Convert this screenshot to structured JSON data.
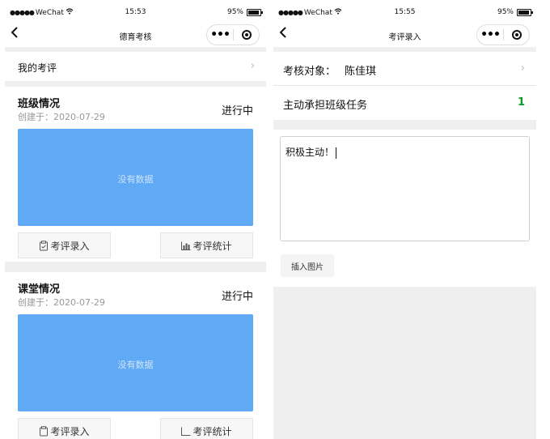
{
  "left": {
    "status": {
      "carrier": "WeChat",
      "time": "15:53",
      "battery": "95%"
    },
    "nav": {
      "title": "德育考核"
    },
    "my_eval": {
      "label": "我的考评"
    },
    "cards": [
      {
        "title": "班级情况",
        "created": "创建于：2020-07-29",
        "status": "进行中",
        "nodata": "没有数据",
        "btn1": "考评录入",
        "btn2": "考评统计"
      },
      {
        "title": "课堂情况",
        "created": "创建于：2020-07-29",
        "status": "进行中",
        "nodata": "没有数据",
        "btn1": "考评录入",
        "btn2": "考评统计"
      }
    ]
  },
  "right": {
    "status": {
      "carrier": "WeChat",
      "time": "15:55",
      "battery": "95%"
    },
    "nav": {
      "title": "考评录入"
    },
    "target_row": {
      "label": "考核对象：",
      "name": "陈佳琪"
    },
    "task_row": {
      "label": "主动承担班级任务",
      "value": "1"
    },
    "editor": {
      "text": "积极主动！"
    },
    "insert_image": "插入图片"
  },
  "colors": {
    "chart_bg": "#5fa9f5",
    "score_green": "#0a9a28",
    "page_bg": "#efefef"
  },
  "icons": [
    "back-arrow-icon",
    "more-icon",
    "target-icon",
    "chevron-right-icon",
    "clipboard-icon",
    "bar-chart-icon",
    "wifi-icon",
    "battery-icon"
  ]
}
